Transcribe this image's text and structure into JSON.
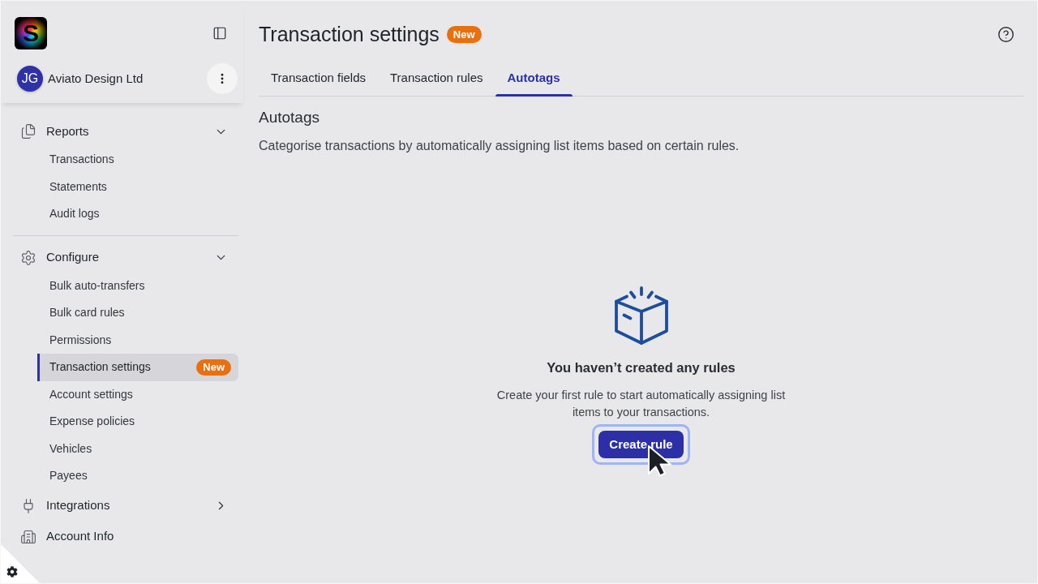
{
  "sidebar": {
    "logo": {
      "letter": "S"
    },
    "account": {
      "initials": "JG",
      "name": "Aviato Design Ltd"
    },
    "nav_sections": [
      {
        "items": [
          {
            "kind": "group",
            "label": "Reports",
            "expanded": true,
            "children": [
              {
                "label": "Transactions",
                "selected": false
              },
              {
                "label": "Statements",
                "selected": false
              },
              {
                "label": "Audit logs",
                "selected": false
              }
            ]
          }
        ]
      },
      {
        "items": [
          {
            "kind": "group",
            "label": "Configure",
            "expanded": true,
            "children": [
              {
                "label": "Bulk auto-transfers",
                "selected": false
              },
              {
                "label": "Bulk card rules",
                "selected": false
              },
              {
                "label": "Permissions",
                "selected": false
              },
              {
                "label": "Transaction settings",
                "selected": true,
                "badge": "New"
              },
              {
                "label": "Account settings",
                "selected": false
              },
              {
                "label": "Expense policies",
                "selected": false
              },
              {
                "label": "Vehicles",
                "selected": false
              },
              {
                "label": "Payees",
                "selected": false
              }
            ]
          },
          {
            "kind": "group",
            "label": "Integrations",
            "expanded": false
          },
          {
            "kind": "link",
            "label": "Account Info"
          }
        ]
      }
    ]
  },
  "page": {
    "title": "Transaction settings",
    "badge": "New"
  },
  "tabs": [
    {
      "label": "Transaction fields",
      "selected": false
    },
    {
      "label": "Transaction rules",
      "selected": false
    },
    {
      "label": "Autotags",
      "selected": true
    }
  ],
  "section": {
    "heading": "Autotags",
    "description": "Categorise transactions by automatically assigning list items based on certain rules."
  },
  "empty_state": {
    "title": "You haven’t created any rules",
    "text": "Create your first rule to start automatically assigning list items to your transactions.",
    "button": "Create rule"
  }
}
